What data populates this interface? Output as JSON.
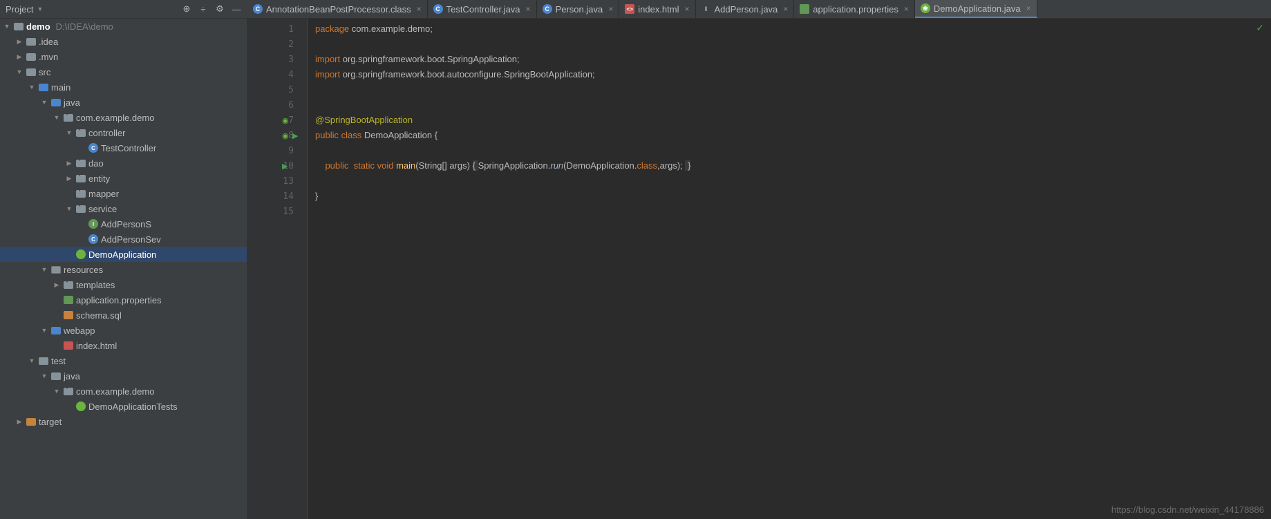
{
  "header": {
    "title": "Project",
    "rootName": "demo",
    "rootPath": "D:\\IDEA\\demo"
  },
  "tabs": [
    {
      "label": "AnnotationBeanPostProcessor.class",
      "iconType": "class",
      "active": false,
      "truncated": true
    },
    {
      "label": "TestController.java",
      "iconType": "java",
      "active": false
    },
    {
      "label": "Person.java",
      "iconType": "java",
      "active": false
    },
    {
      "label": "index.html",
      "iconType": "html",
      "active": false
    },
    {
      "label": "AddPerson.java",
      "iconType": "interface",
      "active": false
    },
    {
      "label": "application.properties",
      "iconType": "props",
      "active": false
    },
    {
      "label": "DemoApplication.java",
      "iconType": "spring",
      "active": true
    }
  ],
  "tree": [
    {
      "depth": 0,
      "arrow": "down",
      "icon": "folder",
      "label": "demo",
      "bold": true,
      "path": "D:\\IDEA\\demo"
    },
    {
      "depth": 1,
      "arrow": "right",
      "icon": "folder",
      "label": ".idea"
    },
    {
      "depth": 1,
      "arrow": "right",
      "icon": "folder",
      "label": ".mvn"
    },
    {
      "depth": 1,
      "arrow": "down",
      "icon": "folder",
      "label": "src"
    },
    {
      "depth": 2,
      "arrow": "down",
      "icon": "folder-blue",
      "label": "main"
    },
    {
      "depth": 3,
      "arrow": "down",
      "icon": "folder-blue",
      "label": "java"
    },
    {
      "depth": 4,
      "arrow": "down",
      "icon": "package",
      "label": "com.example.demo"
    },
    {
      "depth": 5,
      "arrow": "down",
      "icon": "package",
      "label": "controller"
    },
    {
      "depth": 6,
      "arrow": "none",
      "icon": "java-file",
      "label": "TestController"
    },
    {
      "depth": 5,
      "arrow": "right",
      "icon": "package",
      "label": "dao"
    },
    {
      "depth": 5,
      "arrow": "right",
      "icon": "package",
      "label": "entity"
    },
    {
      "depth": 5,
      "arrow": "none",
      "icon": "package",
      "label": "mapper"
    },
    {
      "depth": 5,
      "arrow": "down",
      "icon": "package",
      "label": "service"
    },
    {
      "depth": 6,
      "arrow": "none",
      "icon": "interface",
      "label": "AddPersonS"
    },
    {
      "depth": 6,
      "arrow": "none",
      "icon": "java-file",
      "label": "AddPersonSev"
    },
    {
      "depth": 5,
      "arrow": "none",
      "icon": "spring-file",
      "label": "DemoApplication",
      "selected": true
    },
    {
      "depth": 3,
      "arrow": "down",
      "icon": "folder-res",
      "label": "resources"
    },
    {
      "depth": 4,
      "arrow": "right",
      "icon": "package",
      "label": "templates"
    },
    {
      "depth": 4,
      "arrow": "none",
      "icon": "props-file",
      "label": "application.properties"
    },
    {
      "depth": 4,
      "arrow": "none",
      "icon": "sql-file",
      "label": "schema.sql"
    },
    {
      "depth": 3,
      "arrow": "down",
      "icon": "folder-blue",
      "label": "webapp"
    },
    {
      "depth": 4,
      "arrow": "none",
      "icon": "html-file",
      "label": "index.html"
    },
    {
      "depth": 2,
      "arrow": "down",
      "icon": "folder",
      "label": "test"
    },
    {
      "depth": 3,
      "arrow": "down",
      "icon": "folder",
      "label": "java"
    },
    {
      "depth": 4,
      "arrow": "down",
      "icon": "package",
      "label": "com.example.demo"
    },
    {
      "depth": 5,
      "arrow": "none",
      "icon": "spring-file",
      "label": "DemoApplicationTests"
    },
    {
      "depth": 1,
      "arrow": "right",
      "icon": "folder-orange",
      "label": "target"
    }
  ],
  "lineNumbers": [
    "1",
    "2",
    "3",
    "4",
    "5",
    "6",
    "7",
    "8",
    "9",
    "10",
    "13",
    "14",
    "15"
  ],
  "code": {
    "line1_kw": "package",
    "line1_rest": " com.example.demo;",
    "line3_kw": "import",
    "line3_rest": " org.springframework.boot.SpringApplication;",
    "line4_kw": "import",
    "line4_rest": " org.springframework.boot.autoconfigure.SpringBootApplication;",
    "line7_anno": "@SpringBootApplication",
    "line8_kw": "public class",
    "line8_name": " DemoApplication ",
    "line8_brace": "{",
    "line10_indent": "    ",
    "line10_kw": "public  static void",
    "line10_method": " main",
    "line10_args": "(String[] args) ",
    "line10_brace1": "{ ",
    "line10_call": "SpringApplication.",
    "line10_run": "run",
    "line10_params": "(DemoApplication.",
    "line10_class": "class",
    "line10_end": ",args); ",
    "line10_brace2": " }",
    "line14": "}"
  },
  "watermark": "https://blog.csdn.net/weixin_44178886"
}
